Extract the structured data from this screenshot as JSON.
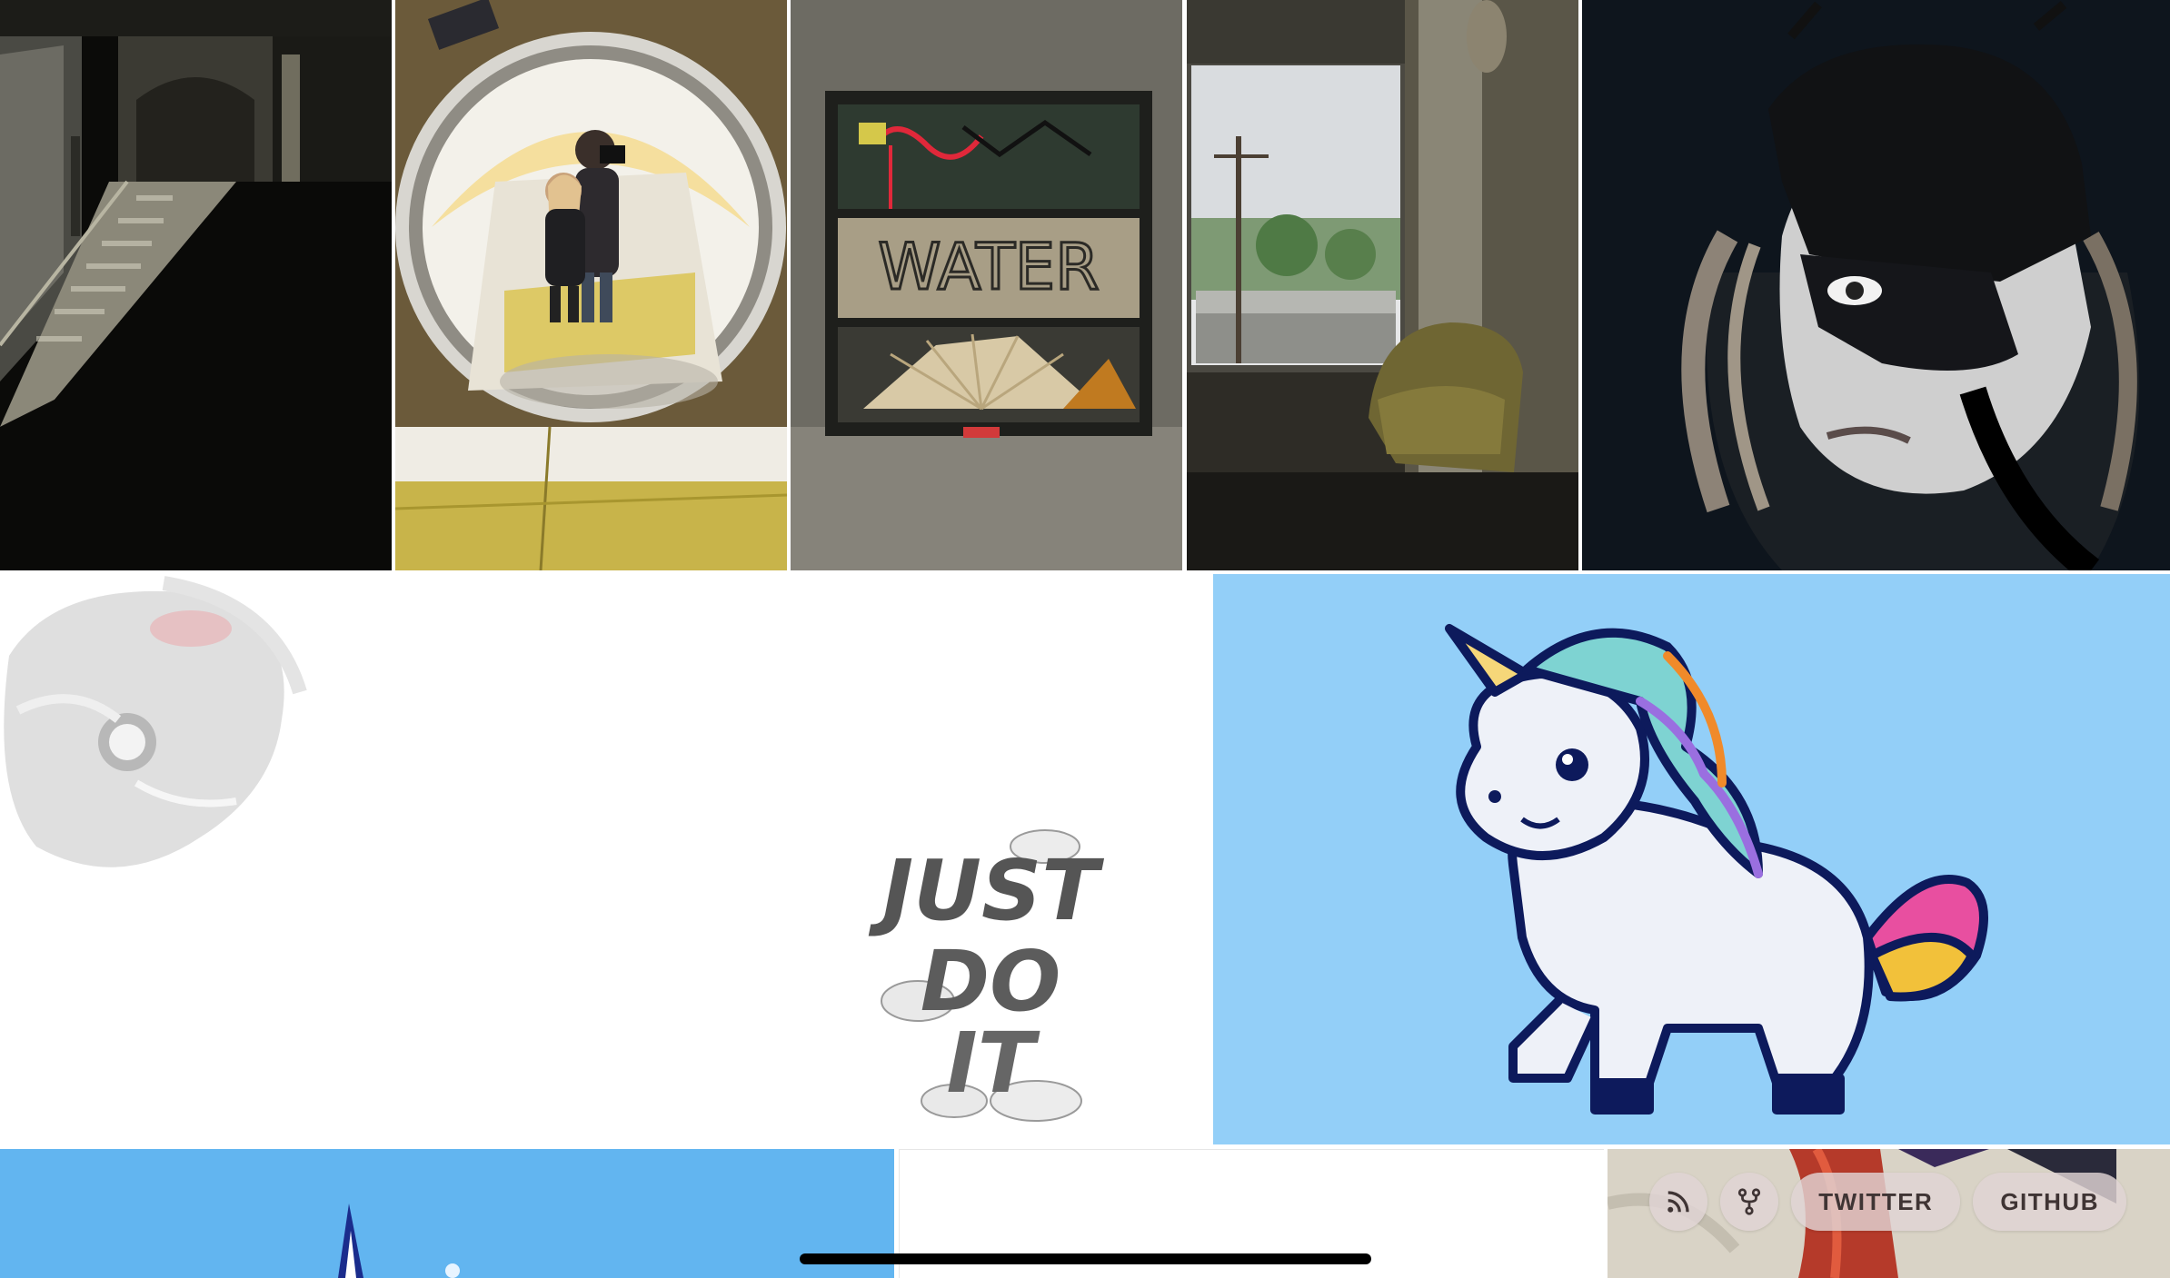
{
  "gallery": {
    "tiles": [
      {
        "id": "subway-stairs",
        "kind": "photo"
      },
      {
        "id": "convex-mirror-selfie",
        "kind": "photo"
      },
      {
        "id": "water-graffiti-window",
        "kind": "photo",
        "text": "WATER"
      },
      {
        "id": "hotel-window-chair",
        "kind": "photo"
      },
      {
        "id": "masked-woman-portrait",
        "kind": "photo"
      },
      {
        "id": "just-do-it-artwork",
        "kind": "illustration",
        "text": [
          "JUST",
          "DO",
          "IT"
        ]
      },
      {
        "id": "rainbow-unicorn",
        "kind": "illustration"
      },
      {
        "id": "blue-sky-sailboat",
        "kind": "illustration"
      },
      {
        "id": "white-blank",
        "kind": "illustration"
      },
      {
        "id": "anime-character",
        "kind": "illustration"
      }
    ]
  },
  "actions": {
    "rss_icon": "rss-icon",
    "fork_icon": "fork-icon",
    "twitter_label": "TWITTER",
    "github_label": "GITHUB"
  },
  "colors": {
    "unicorn_bg": "#93cff8",
    "sky_bg": "#62b5f0",
    "fab_bg": "#e1d4d4",
    "fab_text": "#3f3434"
  }
}
